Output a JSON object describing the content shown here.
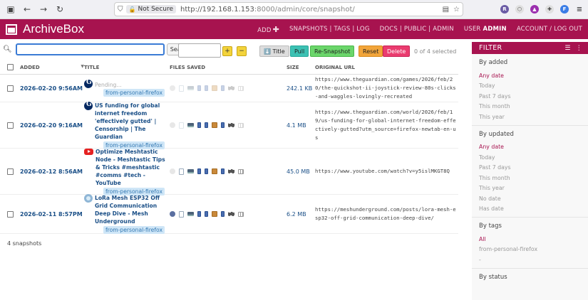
{
  "browser": {
    "not_secure": "Not Secure",
    "url_host": "http://192.168.1.153",
    "url_path": ":8000/admin/core/snapshot/"
  },
  "header": {
    "brand": "ArchiveBox",
    "nav": {
      "add": "ADD",
      "snapshots": "SNAPSHOTS | TAGS | LOG",
      "docs": "DOCS | PUBLIC | ADMIN",
      "user_label": "USER",
      "user_name": "ADMIN",
      "account": "ACCOUNT / LOG OUT"
    }
  },
  "toolbar": {
    "search_value": "",
    "search_button": "Search",
    "plus": "+",
    "minus": "−",
    "title_button": "⬇️ Title",
    "pull_button": "Pull",
    "resnapshot_button": "Re-Snapshot",
    "reset_button": "Reset",
    "delete_button": "Delete",
    "selected": "0 of 4 selected"
  },
  "table": {
    "columns": {
      "added": "ADDED",
      "title": "TITLE",
      "files": "FILES SAVED",
      "size": "SIZE",
      "url": "ORIGINAL URL"
    },
    "rows": [
      {
        "added": "2026-02-20 9:56AM",
        "title": "Pending...",
        "favicon": "guardian-icon",
        "tag": "from-personal-firefox",
        "size": "242.1 KB",
        "url": "https://www.theguardian.com/games/2026/feb/20/the-quickshot-ii-joystick-review-80s-clicks-and-waggles-lovingly-recreated"
      },
      {
        "added": "2026-02-20 9:16AM",
        "title": "US funding for global internet freedom 'effectively gutted' | Censorship | The Guardian",
        "favicon": "guardian-icon",
        "tag": "from-personal-firefox",
        "size": "4.1 MB",
        "url": "https://www.theguardian.com/world/2026/feb/19/us-funding-for-global-internet-freedom-effectively-gutted?utm_source=firefox-newtab-en-us"
      },
      {
        "added": "2026-02-12 8:56AM",
        "title": "Optimize Meshtastic Node - Meshtastic Tips & Tricks #meshtastic #comms #tech - YouTube",
        "favicon": "youtube-icon",
        "tag": "from-personal-firefox",
        "size": "45.0 MB",
        "url": "https://www.youtube.com/watch?v=y5islMKGT8Q"
      },
      {
        "added": "2026-02-11 8:57PM",
        "title": "LoRa Mesh ESP32 Off Grid Communication Deep Dive - Mesh Underground",
        "favicon": "mesh-icon",
        "tag": "from-personal-firefox",
        "size": "6.2 MB",
        "url": "https://meshunderground.com/posts/lora-mesh-esp32-off-grid-communication-deep-dive/"
      }
    ],
    "footer": "4 snapshots"
  },
  "filter": {
    "title": "FILTER",
    "groups": [
      {
        "title": "By added",
        "items": [
          "Any date",
          "Today",
          "Past 7 days",
          "This month",
          "This year"
        ]
      },
      {
        "title": "By updated",
        "items": [
          "Any date",
          "Today",
          "Past 7 days",
          "This month",
          "This year",
          "No date",
          "Has date"
        ]
      },
      {
        "title": "By tags",
        "items": [
          "All",
          "from-personal-firefox",
          "-"
        ]
      },
      {
        "title": "By status",
        "items": []
      }
    ]
  },
  "colors": {
    "brand": "#a7134f",
    "link": "#1a4f87",
    "tag_bg": "#cfe6f7"
  }
}
